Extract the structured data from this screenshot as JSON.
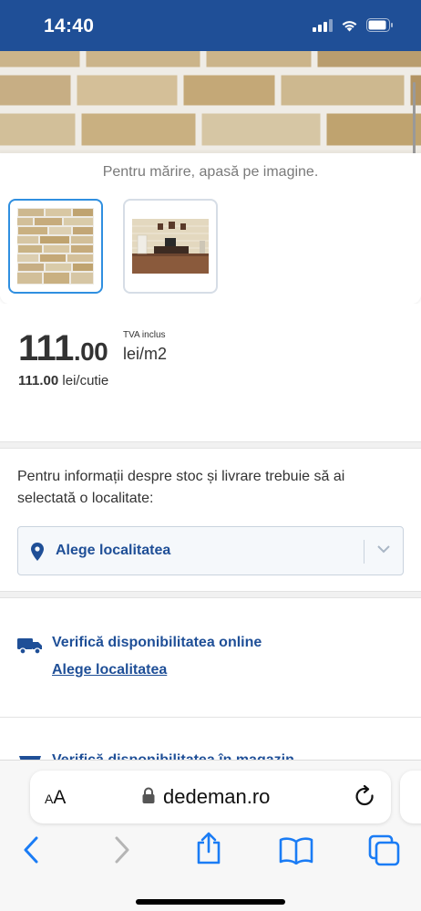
{
  "status_bar": {
    "time": "14:40",
    "icons": [
      "cellular-signal-icon",
      "wifi-icon",
      "battery-icon"
    ]
  },
  "gallery": {
    "zoom_hint": "Pentru mărire, apasă pe imagine.",
    "thumbnails": [
      "brick-wall-thumbnail",
      "room-interior-thumbnail"
    ],
    "selected_index": 0
  },
  "price": {
    "integer": "111",
    "decimals": ".00",
    "vat_note": "TVA inclus",
    "unit": "lei/m2",
    "box_value": "111.00",
    "box_unit": "lei/cutie"
  },
  "stock": {
    "info_text": "Pentru informații despre stoc și livrare trebuie să ai selectată o localitate:",
    "select_label": "Alege localitatea"
  },
  "availability": {
    "online_title": "Verifică disponibilitatea online",
    "online_link": "Alege localitatea",
    "store_title": "Verifică disponibilitatea în magazin"
  },
  "safari": {
    "text_size_label_small": "A",
    "text_size_label_large": "A",
    "domain": "dedeman.ro"
  },
  "colors": {
    "brand_blue": "#1f4f97",
    "selected_thumb_border": "#2f8fe0",
    "safari_accent": "#1a7cf5"
  }
}
